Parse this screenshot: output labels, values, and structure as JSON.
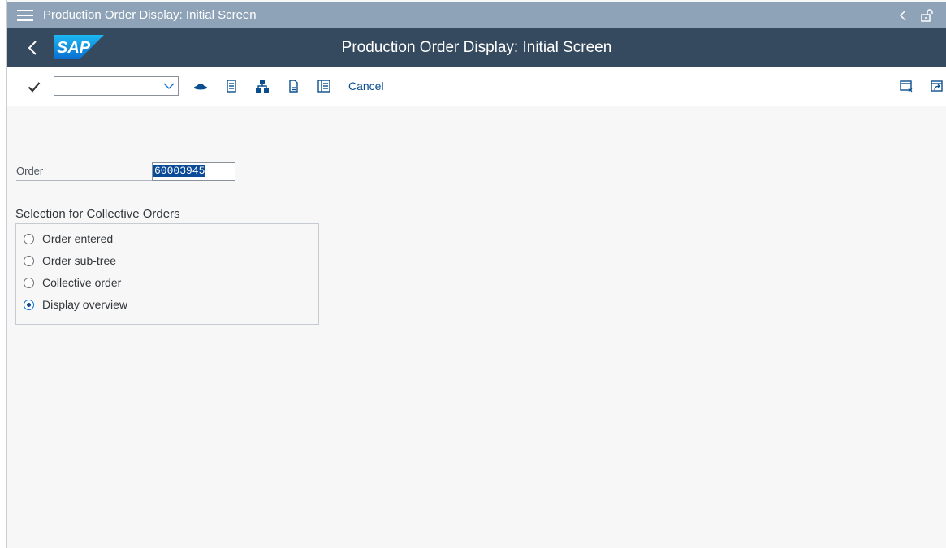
{
  "shell": {
    "title": "Production Order Display: Initial Screen",
    "icons": [
      "menu-icon",
      "chevron-left-icon",
      "unlock-icon"
    ]
  },
  "header": {
    "logo_text": "SAP",
    "title": "Production Order Display: Initial Screen",
    "colors": {
      "shell_bar": "#8ea3b8",
      "header_bar": "#354a5f",
      "logo": "#0a6ed1"
    }
  },
  "toolbar": {
    "command_field_value": "",
    "icons": [
      "checkmark-icon",
      "hat-icon",
      "document-list-icon",
      "hierarchy-icon",
      "copy-icon",
      "form-icon",
      "new-window-icon",
      "external-link-icon"
    ],
    "cancel_label": "Cancel"
  },
  "form": {
    "order_label": "Order",
    "order_value": "60003945"
  },
  "selection": {
    "title": "Selection for Collective Orders",
    "options": [
      {
        "label": "Order entered",
        "selected": false
      },
      {
        "label": "Order sub-tree",
        "selected": false
      },
      {
        "label": "Collective order",
        "selected": false
      },
      {
        "label": "Display overview",
        "selected": true
      }
    ]
  }
}
